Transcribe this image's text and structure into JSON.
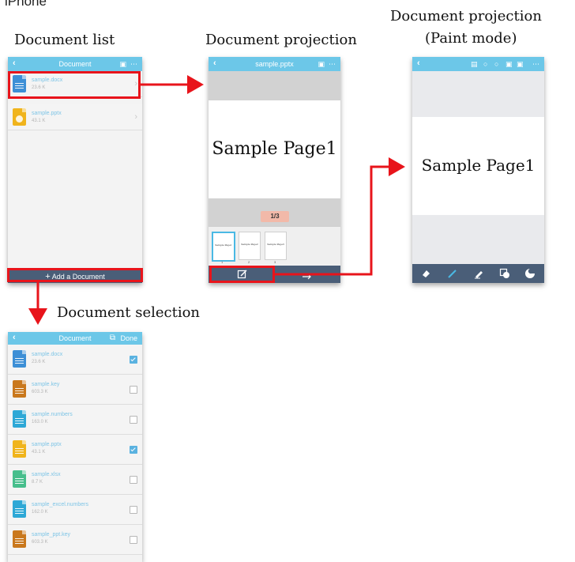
{
  "device_label": "iPhone",
  "captions": {
    "list": "Document list",
    "projection": "Document projection",
    "paint_line1": "Document projection",
    "paint_line2": "(Paint mode)",
    "selection": "Document selection"
  },
  "list_screen": {
    "title": "Document",
    "files": [
      {
        "name": "sample.docx",
        "size": "23.6 K"
      },
      {
        "name": "sample.pptx",
        "size": "43.1 K"
      }
    ],
    "add_label": "Add a Document"
  },
  "projection_screen": {
    "title": "sample.pptx",
    "slide_text": "Sample Page1",
    "page_indicator": "1/3",
    "thumbs": [
      {
        "text": "Sample Page1",
        "num": "1"
      },
      {
        "text": "Sample Page2",
        "num": "2"
      },
      {
        "text": "Sample Page3",
        "num": "3"
      }
    ]
  },
  "paint_screen": {
    "slide_text": "Sample Page1"
  },
  "selection_screen": {
    "title": "Document",
    "done_label": "Done",
    "files": [
      {
        "name": "sample.docx",
        "size": "23.6 K",
        "checked": true,
        "color": "#3d8fd6"
      },
      {
        "name": "sample.key",
        "size": "603.3 K",
        "checked": false,
        "color": "#c9781d"
      },
      {
        "name": "sample.numbers",
        "size": "163.0 K",
        "checked": false,
        "color": "#2ea8d6"
      },
      {
        "name": "sample.pptx",
        "size": "43.1 K",
        "checked": true,
        "color": "#f0b41c"
      },
      {
        "name": "sample.xlsx",
        "size": "8.7 K",
        "checked": false,
        "color": "#47be8c"
      },
      {
        "name": "sample_excel.numbers",
        "size": "162.0 K",
        "checked": false,
        "color": "#2ea8d6"
      },
      {
        "name": "sample_ppt.key",
        "size": "603.3 K",
        "checked": false,
        "color": "#c9781d"
      }
    ]
  },
  "colors": {
    "topbar": "#6cc7e8",
    "bottombar": "#4a5e78",
    "highlight": "#e8141b",
    "filename": "#7fc5e6"
  }
}
